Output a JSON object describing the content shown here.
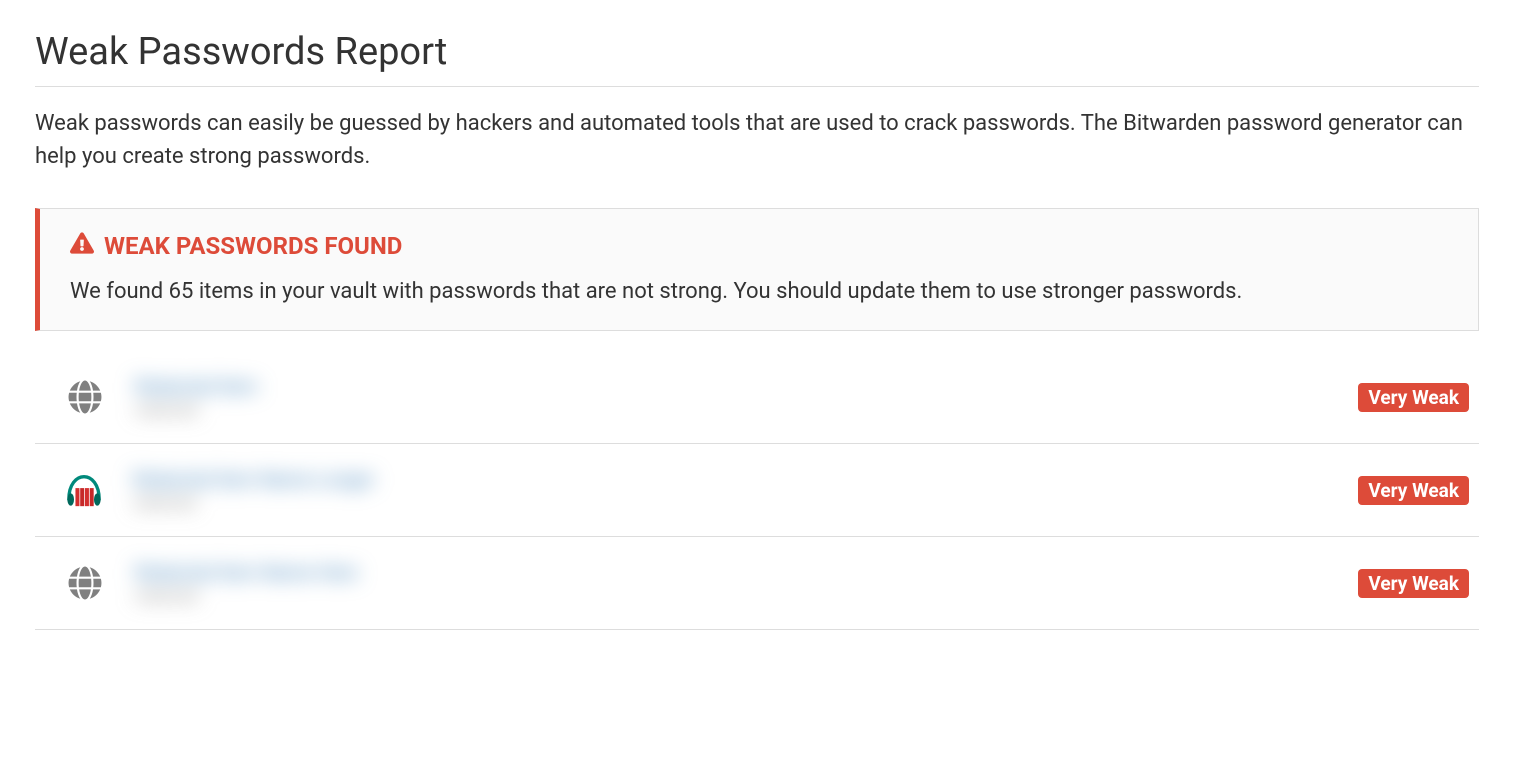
{
  "page": {
    "title": "Weak Passwords Report",
    "description": "Weak passwords can easily be guessed by hackers and automated tools that are used to crack passwords. The Bitwarden password generator can help you create strong passwords."
  },
  "alert": {
    "title": "Weak Passwords Found",
    "message": "We found 65 items in your vault with passwords that are not strong. You should update them to use stronger passwords."
  },
  "colors": {
    "danger": "#dd4b39",
    "text": "#333333",
    "border": "#dddddd",
    "link": "#337ab7",
    "muted": "#808080"
  },
  "items": [
    {
      "icon": "globe",
      "name": "Redacted Item",
      "sub": "redacted",
      "strength": "Very Weak"
    },
    {
      "icon": "headphones-books",
      "name": "Redacted Item Name Longer",
      "sub": "redacted",
      "strength": "Very Weak"
    },
    {
      "icon": "globe",
      "name": "Redacted Item Name Here",
      "sub": "redacted",
      "strength": "Very Weak"
    }
  ]
}
